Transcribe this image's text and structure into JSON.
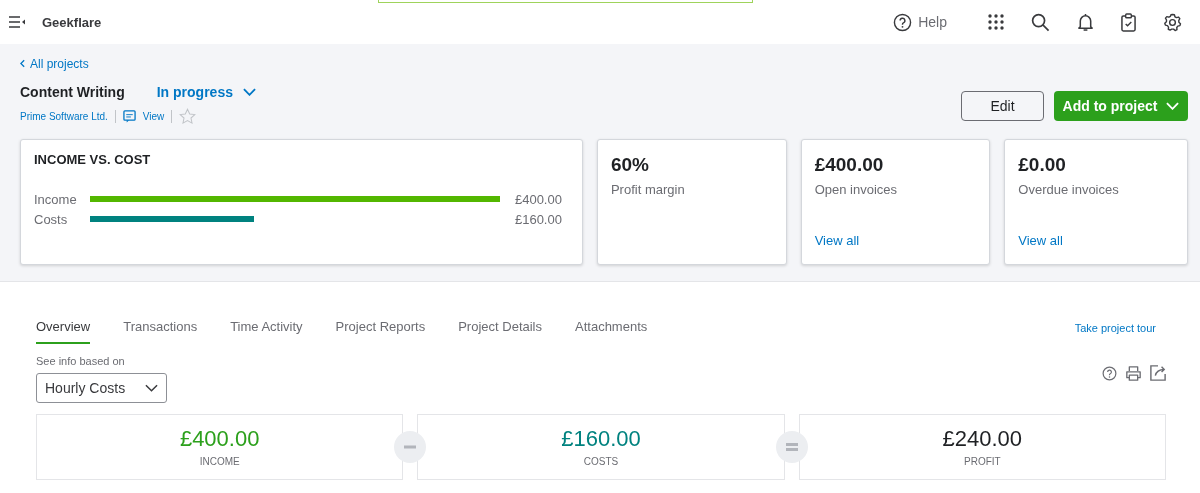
{
  "topbar": {
    "company": "Geekflare",
    "help": "Help"
  },
  "back_link": "All projects",
  "project": {
    "name": "Content Writing",
    "status": "In progress",
    "customer": "Prime Software Ltd.",
    "view": "View",
    "starred": false
  },
  "actions": {
    "edit": "Edit",
    "add": "Add to project"
  },
  "income_vs_cost": {
    "title": "INCOME VS. COST",
    "rows": [
      {
        "label": "Income",
        "amount": "£400.00",
        "color": "#53b700"
      },
      {
        "label": "Costs",
        "amount": "£160.00",
        "color": "#00827f"
      }
    ]
  },
  "stat_cards": [
    {
      "value": "60%",
      "label": "Profit margin"
    },
    {
      "value": "£400.00",
      "label": "Open invoices",
      "link": "View all"
    },
    {
      "value": "£0.00",
      "label": "Overdue invoices",
      "link": "View all"
    }
  ],
  "tabs": [
    {
      "label": "Overview",
      "selected": true
    },
    {
      "label": "Transactions",
      "selected": false
    },
    {
      "label": "Time Activity",
      "selected": false
    },
    {
      "label": "Project Reports",
      "selected": false
    },
    {
      "label": "Project Details",
      "selected": false
    },
    {
      "label": "Attachments",
      "selected": false
    }
  ],
  "tour_link": "Take project tour",
  "basis": {
    "label": "See info based on",
    "value": "Hourly Costs"
  },
  "totals": [
    {
      "amount": "£400.00",
      "label": "INCOME",
      "color": "#2ca01c"
    },
    {
      "amount": "£160.00",
      "label": "COSTS",
      "color": "#00827f"
    },
    {
      "amount": "£240.00",
      "label": "PROFIT",
      "color": "#1f2124"
    }
  ]
}
